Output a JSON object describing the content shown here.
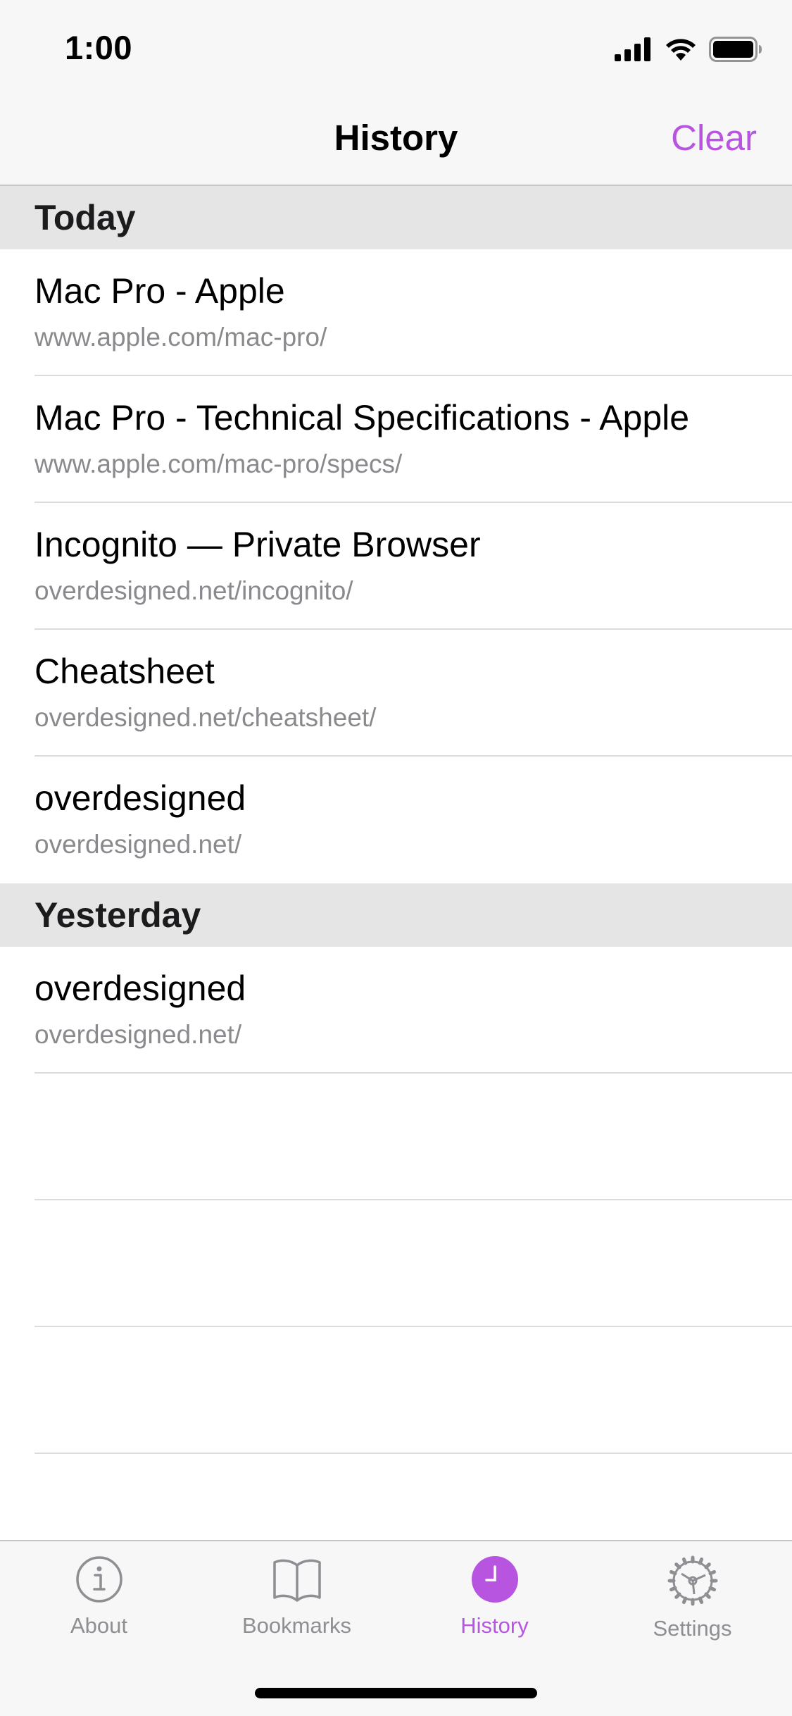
{
  "status_bar": {
    "time": "1:00"
  },
  "nav": {
    "title": "History",
    "clear_label": "Clear"
  },
  "colors": {
    "accent": "#b855e0",
    "section_bg": "#e5e5e6",
    "secondary_text": "#8a8a8e"
  },
  "sections": [
    {
      "title": "Today",
      "items": [
        {
          "title": "Mac Pro - Apple",
          "url": "www.apple.com/mac-pro/"
        },
        {
          "title": "Mac Pro - Technical Specifications - Apple",
          "url": "www.apple.com/mac-pro/specs/"
        },
        {
          "title": "Incognito — Private Browser",
          "url": "overdesigned.net/incognito/"
        },
        {
          "title": "Cheatsheet",
          "url": "overdesigned.net/cheatsheet/"
        },
        {
          "title": "overdesigned",
          "url": "overdesigned.net/"
        }
      ]
    },
    {
      "title": "Yesterday",
      "items": [
        {
          "title": "overdesigned",
          "url": "overdesigned.net/"
        }
      ]
    }
  ],
  "tab_bar": {
    "tabs": [
      {
        "label": "About",
        "icon": "info-circle-icon",
        "active": false
      },
      {
        "label": "Bookmarks",
        "icon": "book-icon",
        "active": false
      },
      {
        "label": "History",
        "icon": "clock-icon",
        "active": true
      },
      {
        "label": "Settings",
        "icon": "gear-icon",
        "active": false
      }
    ]
  }
}
